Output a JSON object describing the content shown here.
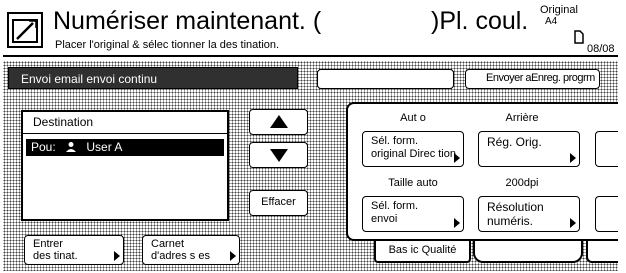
{
  "header": {
    "title": "Numériser maintenant. (",
    "title_right": ")Pl. coul.",
    "subtitle": "Placer l'original & sélec tionner la des tination.",
    "original_label": "Original",
    "original_size": "A4",
    "page_counter": "08/08",
    "icon": "scan-icon",
    "paper_icon": "paper-orientation-icon"
  },
  "status": {
    "mode_text": "Envoi email envoi continu",
    "blank_label": "",
    "save_program_label": "Envoyer aEnreg. progrm"
  },
  "destination": {
    "header": "Destination",
    "rows": [
      {
        "prefix": "Pou:",
        "icon": "user-icon",
        "name": "User A"
      }
    ]
  },
  "buttons": {
    "up_icon": "up-arrow-icon",
    "down_icon": "down-arrow-icon",
    "clear": "Effacer",
    "enter_dest": [
      "Entrer",
      "des tinat."
    ],
    "address_book": [
      "Carnet",
      "d'adres s es"
    ]
  },
  "settings": {
    "auto_label": "Aut o",
    "orig_format": [
      "Sél. form.",
      "original Direc tion"
    ],
    "back_label": "Arrière",
    "orig_adjust": "Rég. Orig.",
    "size_auto_label": "Taille auto",
    "send_format": [
      "Sél. form.",
      "envoi"
    ],
    "dpi_label": "200dpi",
    "resolution": [
      "Résolution",
      "numéris."
    ]
  },
  "tabs": {
    "basic_quality": "Bas ic Qualité",
    "tab2": "",
    "tab3": ""
  }
}
